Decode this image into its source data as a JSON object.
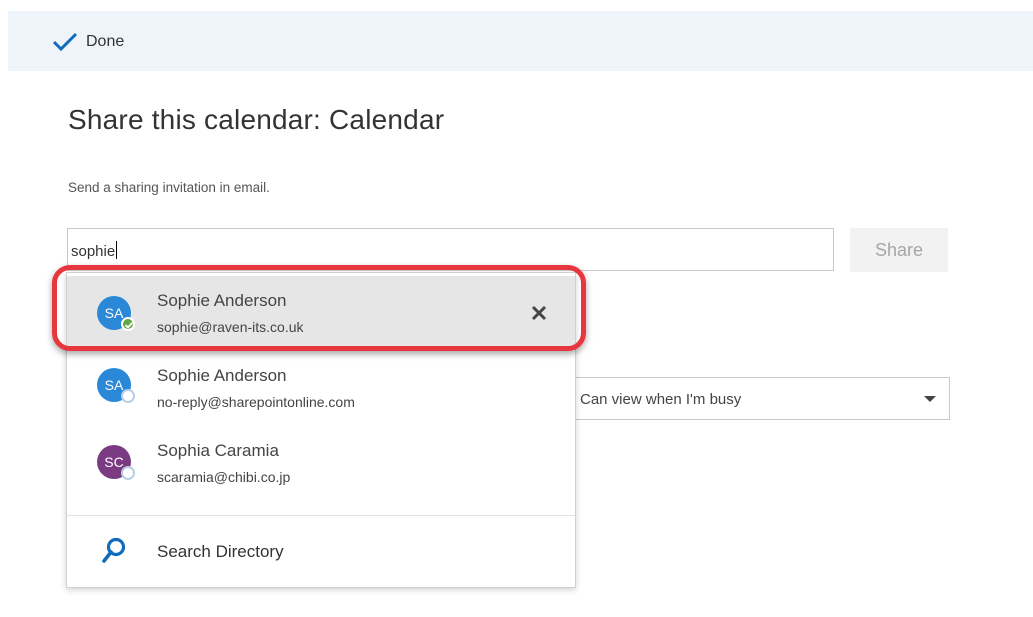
{
  "toolbar": {
    "done_label": "Done"
  },
  "page": {
    "title": "Share this calendar: Calendar",
    "subtitle": "Send a sharing invitation in email."
  },
  "recipient": {
    "value": "sophie"
  },
  "share_button": {
    "label": "Share"
  },
  "permission": {
    "selected": "Can view when I'm busy"
  },
  "suggestions": [
    {
      "initials": "SA",
      "name": "Sophie Anderson",
      "email": "sophie@raven-its.co.uk",
      "avatar_color": "#2b88d8",
      "presence": "available",
      "selected": true
    },
    {
      "initials": "SA",
      "name": "Sophie Anderson",
      "email": "no-reply@sharepointonline.com",
      "avatar_color": "#2b88d8",
      "presence": "unknown",
      "selected": false
    },
    {
      "initials": "SC",
      "name": "Sophia Caramia",
      "email": "scaramia@chibi.co.jp",
      "avatar_color": "#7a3b82",
      "presence": "unknown",
      "selected": false
    }
  ],
  "search_directory": {
    "label": "Search Directory",
    "icon": "search-icon"
  },
  "colors": {
    "accent": "#0078d4",
    "highlight_border": "#e8363e",
    "presence_available": "#62a740"
  }
}
